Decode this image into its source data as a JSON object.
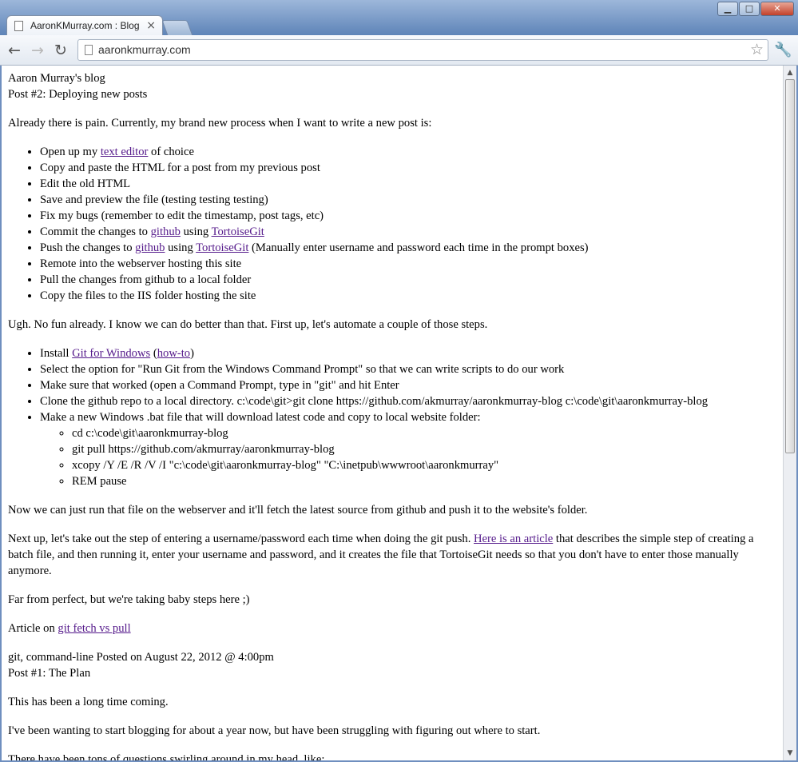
{
  "browser": {
    "tab_title": "AaronKMurray.com : Blog",
    "tab_close": "×",
    "url": "aaronkmurray.com",
    "controls": {
      "minimize": "▁",
      "maximize": "□",
      "close": "✕"
    }
  },
  "blog": {
    "site_title": "Aaron Murray's blog",
    "post2": {
      "title": "Post #2: Deploying new posts",
      "intro": "Already there is pain. Currently, my brand new process when I want to write a new post is:",
      "steps": {
        "s1_pre": "Open up my ",
        "s1_link": "text editor",
        "s1_post": " of choice",
        "s2": "Copy and paste the HTML for a post from my previous post",
        "s3": "Edit the old HTML",
        "s4": "Save and preview the file (testing testing testing)",
        "s5": "Fix my bugs (remember to edit the timestamp, post tags, etc)",
        "s6_pre": "Commit the changes to ",
        "s6_link1": "github",
        "s6_mid": " using ",
        "s6_link2": "TortoiseGit",
        "s7_pre": "Push the changes to ",
        "s7_link1": "github",
        "s7_mid": " using ",
        "s7_link2": "TortoiseGit",
        "s7_post": " (Manually enter username and password each time in the prompt boxes)",
        "s8": "Remote into the webserver hosting this site",
        "s9": "Pull the changes from github to a local folder",
        "s10": "Copy the files to the IIS folder hosting the site"
      },
      "para2": "Ugh. No fun already. I know we can do better than that. First up, let's automate a couple of those steps.",
      "auto": {
        "a1_pre": "Install ",
        "a1_link1": "Git for Windows",
        "a1_mid": " (",
        "a1_link2": "how-to",
        "a1_post": ")",
        "a2": "Select the option for \"Run Git from the Windows Command Prompt\" so that we can write scripts to do our work",
        "a3": "Make sure that worked (open a Command Prompt, type in \"git\" and hit Enter",
        "a4": "Clone the github repo to a local directory. c:\\code\\git>git clone https://github.com/akmurray/aaronkmurray-blog c:\\code\\git\\aaronkmurray-blog",
        "a5": "Make a new Windows .bat file that will download latest code and copy to local website folder:",
        "sub1": "cd c:\\code\\git\\aaronkmurray-blog",
        "sub2": "git pull https://github.com/akmurray/aaronkmurray-blog",
        "sub3": "xcopy /Y /E /R /V /I \"c:\\code\\git\\aaronkmurray-blog\" \"C:\\inetpub\\wwwroot\\aaronkmurray\"",
        "sub4": "REM pause"
      },
      "para3": "Now we can just run that file on the webserver and it'll fetch the latest source from github and push it to the website's folder.",
      "para4_pre": "Next up, let's take out the step of entering a username/password each time when doing the git push. ",
      "para4_link": "Here is an article",
      "para4_post": " that describes the simple step of creating a batch file, and then running it, enter your username and password, and it creates the file that TortoiseGit needs so that you don't have to enter those manually anymore.",
      "para5": "Far from perfect, but we're taking baby steps here ;)",
      "para6_pre": "Article on ",
      "para6_link": "git fetch vs pull",
      "meta": "git, command-line Posted on August 22, 2012 @ 4:00pm"
    },
    "post1": {
      "title": "Post #1: The Plan",
      "p1": "This has been a long time coming.",
      "p2": "I've been wanting to start blogging for about a year now, but have been struggling with figuring out where to start.",
      "p3": "There have been tons of questions swirling around in my head, like:"
    }
  }
}
